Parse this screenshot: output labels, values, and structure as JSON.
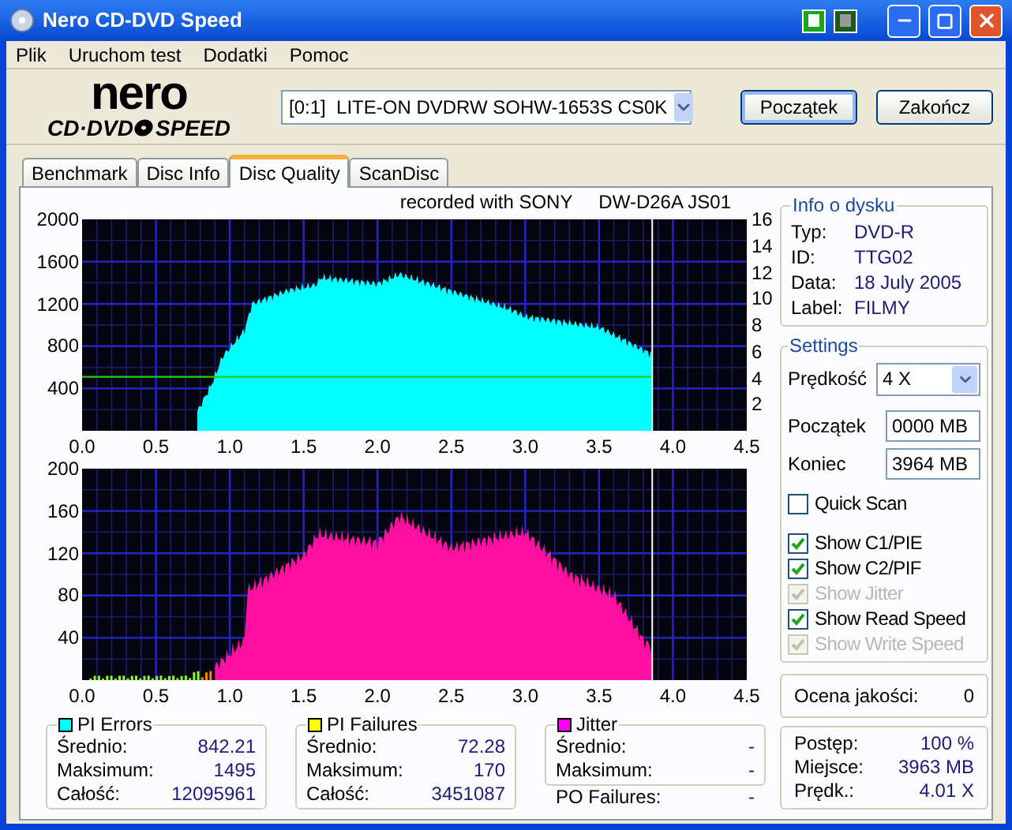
{
  "window": {
    "title": "Nero CD-DVD Speed"
  },
  "menu": [
    {
      "label": "Plik"
    },
    {
      "label": "Uruchom test"
    },
    {
      "label": "Dodatki"
    },
    {
      "label": "Pomoc"
    }
  ],
  "logo": {
    "top": "nero",
    "left": "CD·DVD",
    "right": "SPEED"
  },
  "drive": {
    "value": "[0:1]  LITE-ON DVDRW SOHW-1653S CS0K"
  },
  "buttons": [
    {
      "label": "Początek",
      "selected": true
    },
    {
      "label": "Zakończ",
      "selected": false
    }
  ],
  "tabs": [
    {
      "label": "Benchmark",
      "selected": false
    },
    {
      "label": "Disc Info",
      "selected": false
    },
    {
      "label": "Disc Quality",
      "selected": true
    },
    {
      "label": "ScanDisc",
      "selected": false
    }
  ],
  "caption": "recorded with SONY     DW-D26A JS01",
  "top_chart": {
    "y_ticks": [
      "2000",
      "1600",
      "1200",
      "800",
      "400"
    ],
    "right_ticks": [
      "16",
      "14",
      "12",
      "10",
      "8",
      "6",
      "4",
      "2"
    ],
    "x_ticks": [
      "0.0",
      "0.5",
      "1.0",
      "1.5",
      "2.0",
      "2.5",
      "3.0",
      "3.5",
      "4.0",
      "4.5"
    ]
  },
  "bottom_chart": {
    "y_ticks": [
      "200",
      "160",
      "120",
      "80",
      "40"
    ],
    "x_ticks": [
      "0.0",
      "0.5",
      "1.0",
      "1.5",
      "2.0",
      "2.5",
      "3.0",
      "3.5",
      "4.0",
      "4.5"
    ]
  },
  "disc_info": {
    "title": "Info o dysku",
    "rows": [
      {
        "label": "Typ:",
        "value": "DVD-R"
      },
      {
        "label": "ID:",
        "value": "TTG02"
      },
      {
        "label": "Data:",
        "value": "18 July 2005"
      },
      {
        "label": "Label:",
        "value": "FILMY"
      }
    ]
  },
  "settings": {
    "title": "Settings",
    "speed": {
      "label": "Prędkość",
      "value": "4 X"
    },
    "start": {
      "label": "Początek",
      "value": "0000 MB"
    },
    "end": {
      "label": "Koniec",
      "value": "3964 MB"
    },
    "quick_scan": {
      "label": "Quick Scan",
      "checked": false,
      "disabled": false
    },
    "options": [
      {
        "label": "Show C1/PIE",
        "checked": true,
        "disabled": false
      },
      {
        "label": "Show C2/PIF",
        "checked": true,
        "disabled": false
      },
      {
        "label": "Show Jitter",
        "checked": true,
        "disabled": true
      },
      {
        "label": "Show Read Speed",
        "checked": true,
        "disabled": false
      },
      {
        "label": "Show Write Speed",
        "checked": true,
        "disabled": true
      }
    ]
  },
  "quality": {
    "label": "Ocena jakości:",
    "value": "0"
  },
  "stats": [
    {
      "title": "PI Errors",
      "color": "#00ffff",
      "rows": [
        {
          "label": "Średnio:",
          "value": "842.21"
        },
        {
          "label": "Maksimum:",
          "value": "1495"
        },
        {
          "label": "Całość:",
          "value": "12095961"
        }
      ]
    },
    {
      "title": "PI Failures",
      "color": "#ffff00",
      "rows": [
        {
          "label": "Średnio:",
          "value": "72.28"
        },
        {
          "label": "Maksimum:",
          "value": "170"
        },
        {
          "label": "Całość:",
          "value": "3451087"
        }
      ]
    },
    {
      "title": "Jitter",
      "color": "#ff00ff",
      "rows": [
        {
          "label": "Średnio:",
          "value": "-"
        },
        {
          "label": "Maksimum:",
          "value": "-"
        }
      ]
    }
  ],
  "po_failures": {
    "label": "PO Failures:",
    "value": "-"
  },
  "progress": [
    {
      "label": "Postęp:",
      "value": "100 %"
    },
    {
      "label": "Miejsce:",
      "value": "3963 MB"
    },
    {
      "label": "Prędk.:",
      "value": "4.01 X"
    }
  ]
}
